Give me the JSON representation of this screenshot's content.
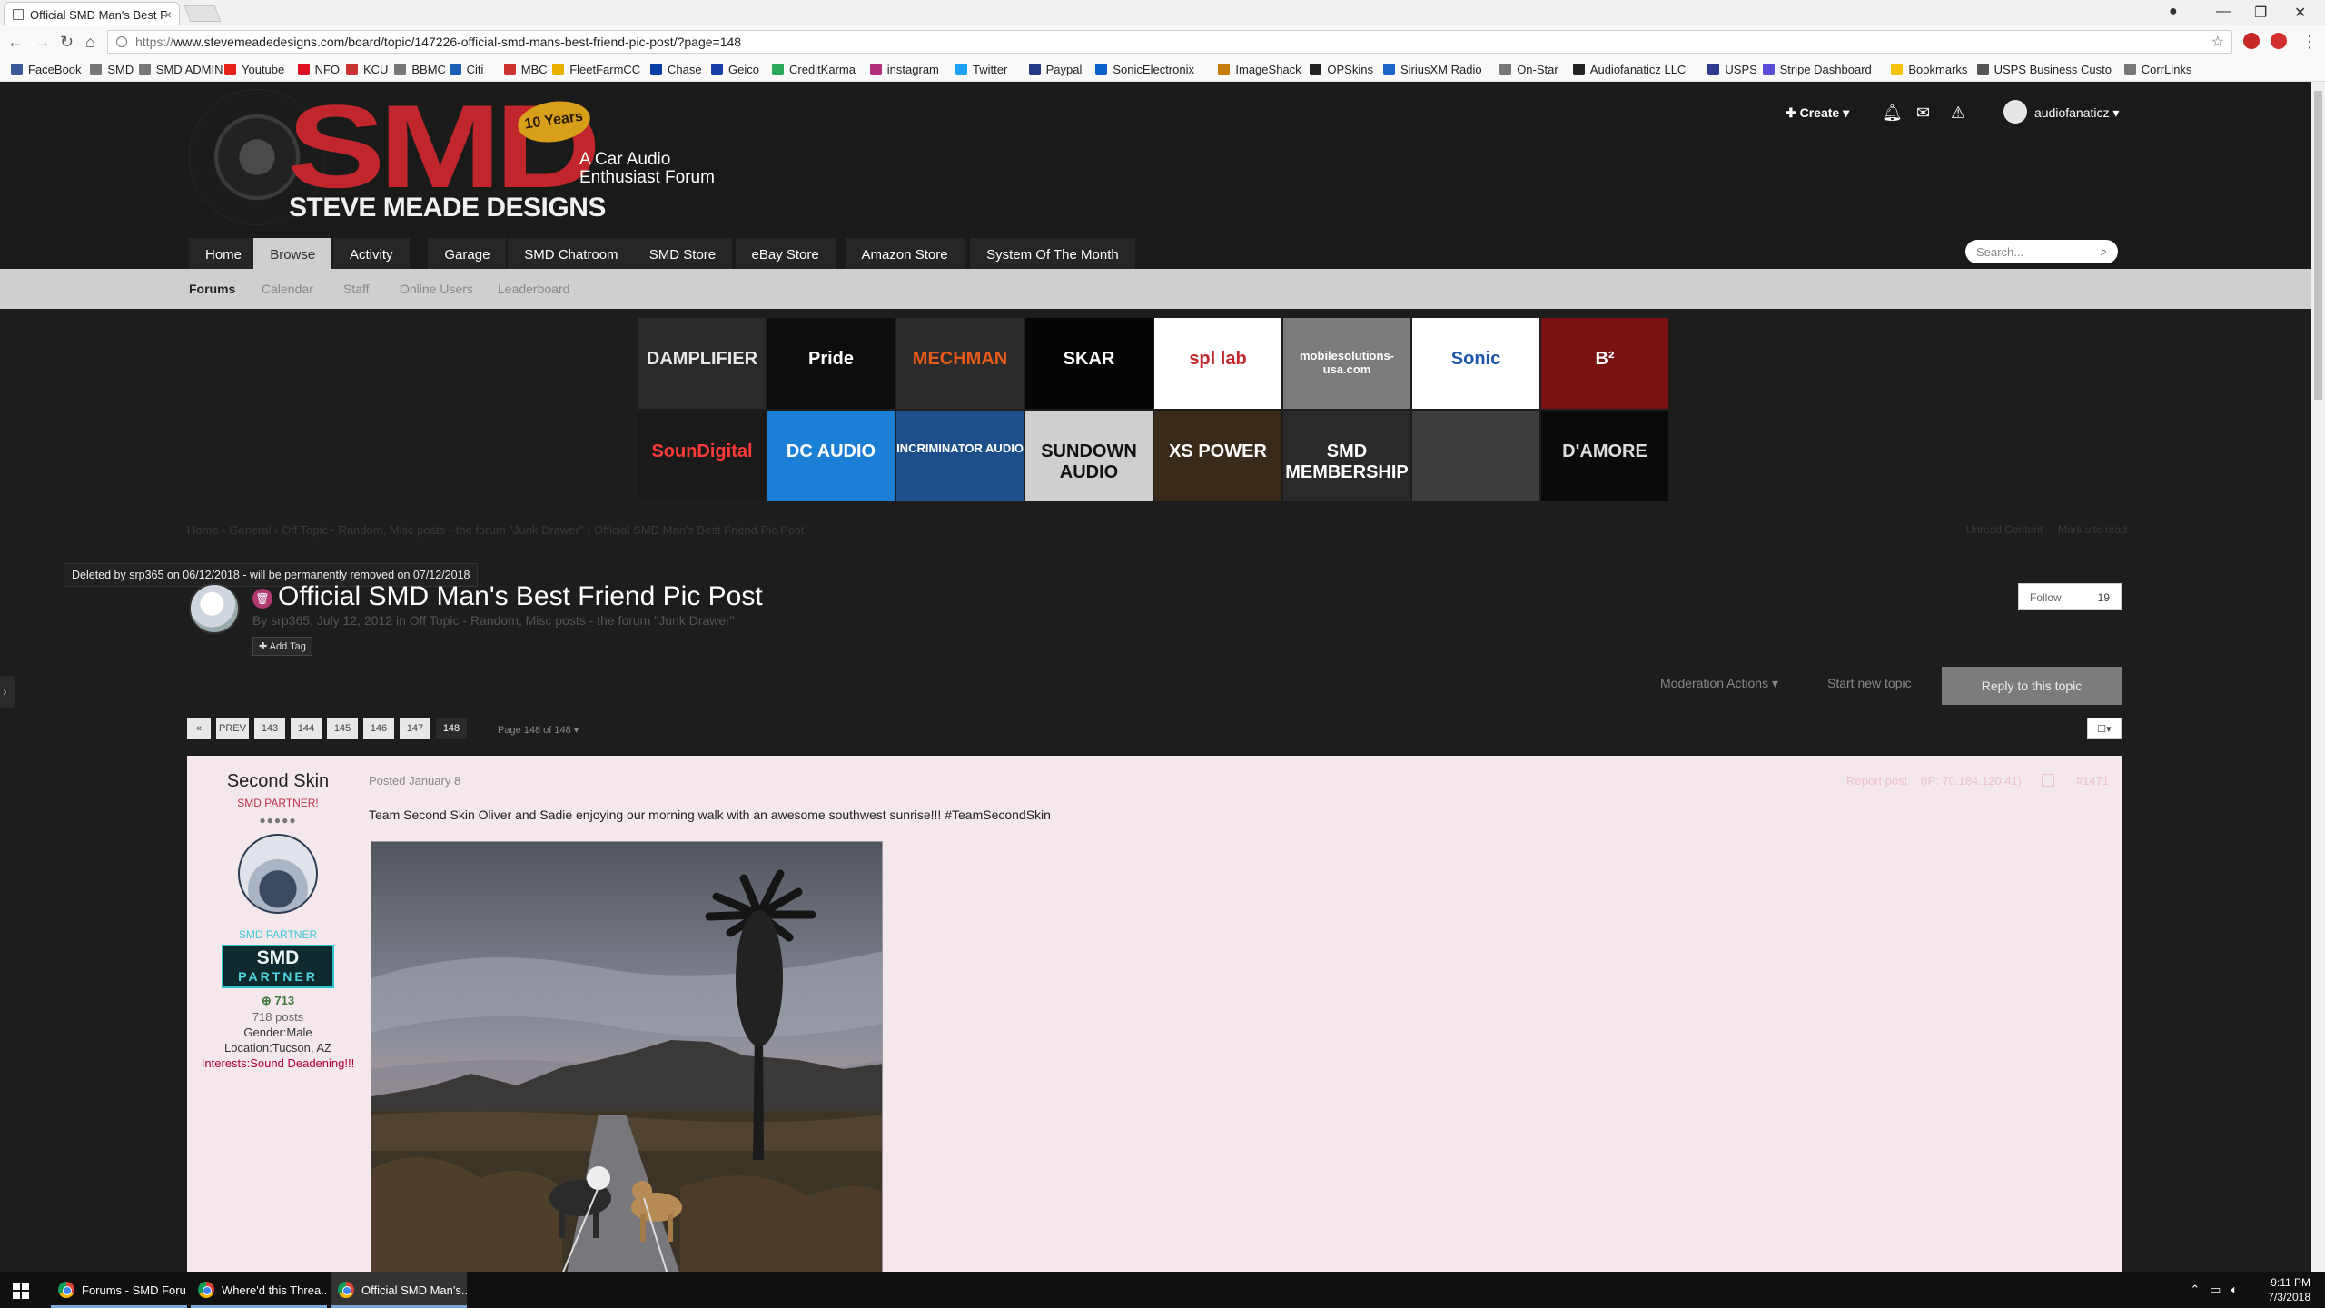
{
  "browser": {
    "tabs": [
      {
        "title": "Official SMD Man's Best F",
        "active": true
      }
    ],
    "url_scheme": "https://",
    "url_rest": "www.stevemeadedesigns.com/board/topic/147226-official-smd-mans-best-friend-pic-post/?page=148",
    "bookmarks": [
      "FaceBook",
      "SMD",
      "SMD ADMIN",
      "Youtube",
      "NFO",
      "KCU",
      "BBMC",
      "Citi",
      "MBC",
      "FleetFarmCC",
      "Chase",
      "Geico",
      "CreditKarma",
      "instagram",
      "Twitter",
      "Paypal",
      "SonicElectronix",
      "ImageShack",
      "OPSkins",
      "SiriusXM Radio",
      "On-Star",
      "Audiofanaticz LLC",
      "USPS",
      "Stripe Dashboard",
      "Bookmarks",
      "USPS Business Custo",
      "CorrLinks"
    ]
  },
  "header": {
    "logo_main": "SMD",
    "logo_sub": "STEVE MEADE DESIGNS",
    "logo_years": "10 Years",
    "tagline_1": "A Car Audio",
    "tagline_2": "Enthusiast Forum",
    "create_label": "Create",
    "username": "audiofanaticz",
    "nav": [
      "Home",
      "Browse",
      "Activity",
      "Garage",
      "SMD Chatroom",
      "SMD Store",
      "eBay Store",
      "Amazon Store",
      "System Of The Month"
    ],
    "active_nav": "Browse",
    "search_placeholder": "Search..."
  },
  "subnav": [
    "Forums",
    "Calendar",
    "Staff",
    "Online Users",
    "Leaderboard"
  ],
  "sponsors": [
    {
      "name": "DAMPLIFIER",
      "bg": "#2a2a2a",
      "fg": "#e8e8e8"
    },
    {
      "name": "Pride",
      "bg": "#0d0d0d",
      "fg": "#ffffff"
    },
    {
      "name": "MECHMAN",
      "bg": "#2b2b2b",
      "fg": "#e85a1a"
    },
    {
      "name": "SKAR",
      "bg": "#050505",
      "fg": "#ffffff"
    },
    {
      "name": "spl lab",
      "bg": "#ffffff",
      "fg": "#c0262b"
    },
    {
      "name": "mobilesolutions-usa.com",
      "bg": "#7b7b7b",
      "fg": "#ffffff"
    },
    {
      "name": "Sonic",
      "bg": "#ffffff",
      "fg": "#1f56a8"
    },
    {
      "name": "B²",
      "bg": "#7a1212",
      "fg": "#ffffff"
    },
    {
      "name": "SounDigital",
      "bg": "#1a1a1a",
      "fg": "#ff3a3a"
    },
    {
      "name": "DC AUDIO",
      "bg": "#1c7fd6",
      "fg": "#ffffff"
    },
    {
      "name": "INCRIMINATOR AUDIO",
      "bg": "#1d4f8a",
      "fg": "#ffffff"
    },
    {
      "name": "SUNDOWN AUDIO",
      "bg": "#cfcfcf",
      "fg": "#111111"
    },
    {
      "name": "XS POWER",
      "bg": "#3a2a1a",
      "fg": "#ffffff"
    },
    {
      "name": "SMD MEMBERSHIP",
      "bg": "#2a2a2a",
      "fg": "#ffffff"
    },
    {
      "name": "",
      "bg": "#3d3d3d",
      "fg": "#ffffff"
    },
    {
      "name": "D'AMORE",
      "bg": "#0a0a0a",
      "fg": "#dddddd"
    }
  ],
  "breadcrumb": {
    "items": [
      "Home",
      "General",
      "Off Topic - Random, Misc posts - the forum \"Junk Drawer\"",
      "Official SMD Man's Best Friend Pic Post"
    ],
    "right_1": "Unread Content",
    "right_2": "Mark site read"
  },
  "topic": {
    "deleted_notice": "Deleted by srp365 on 06/12/2018 - will be permanently removed on 07/12/2018",
    "title": "Official SMD Man's Best Friend Pic Post",
    "by": "By srp365, July 12, 2012 in Off Topic - Random, Misc posts - the forum \"Junk Drawer\"",
    "add_tag": "Add Tag",
    "follow_label": "Follow",
    "follow_count": "19",
    "moderation": "Moderation Actions",
    "start_new": "Start new topic",
    "reply": "Reply to this topic"
  },
  "pagination": {
    "first": "«",
    "prev": "PREV",
    "pages": [
      "143",
      "144",
      "145",
      "146",
      "147",
      "148"
    ],
    "current": "148",
    "page_of": "Page 148 of 148"
  },
  "post": {
    "author": "Second Skin",
    "rank": "SMD PARTNER!",
    "pips": "●●●●●",
    "group": "SMD PARTNER",
    "badge_top": "SMD",
    "badge_bottom": "PARTNER",
    "reputation": "713",
    "posts": "718 posts",
    "gender": "Gender:Male",
    "location": "Location:Tucson, AZ",
    "interests": "Interests:Sound Deadening!!!",
    "date": "Posted January 8",
    "report": "Report post",
    "ip": "(IP: 70.184.120.41)",
    "number": "#1471",
    "text": "Team Second Skin Oliver and Sadie enjoying our morning walk with an awesome southwest sunrise!!! #TeamSecondSkin"
  },
  "taskbar": {
    "items": [
      "Forums - SMD Foru...",
      "Where'd this Threa...",
      "Official SMD Man's..."
    ],
    "time": "9:11 PM",
    "date": "7/3/2018"
  }
}
